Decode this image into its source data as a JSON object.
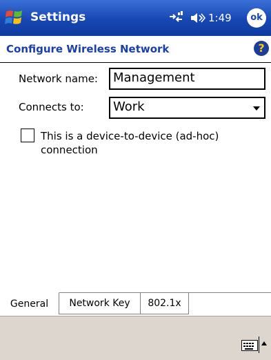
{
  "titlebar": {
    "app_title": "Settings",
    "clock": "1:49",
    "ok_label": "ok",
    "icons": [
      "windows-start-icon",
      "connectivity-icon",
      "volume-icon"
    ]
  },
  "header": {
    "page_title": "Configure Wireless Network",
    "help_label": "?"
  },
  "form": {
    "network_name_label": "Network name:",
    "network_name_value": "Management",
    "connects_to_label": "Connects to:",
    "connects_to_value": "Work",
    "adhoc_label": "This is a device-to-device (ad-hoc) connection",
    "adhoc_checked": false
  },
  "tabs": [
    {
      "label": "General",
      "active": true
    },
    {
      "label": "Network Key",
      "active": false
    },
    {
      "label": "802.1x",
      "active": false
    }
  ],
  "menubar": {
    "icons": [
      "keyboard-icon",
      "input-menu-arrow-icon"
    ]
  },
  "colors": {
    "titlebar": "#1747b3",
    "header_text": "#1a3fa8",
    "menubar": "#dcd6cf"
  }
}
